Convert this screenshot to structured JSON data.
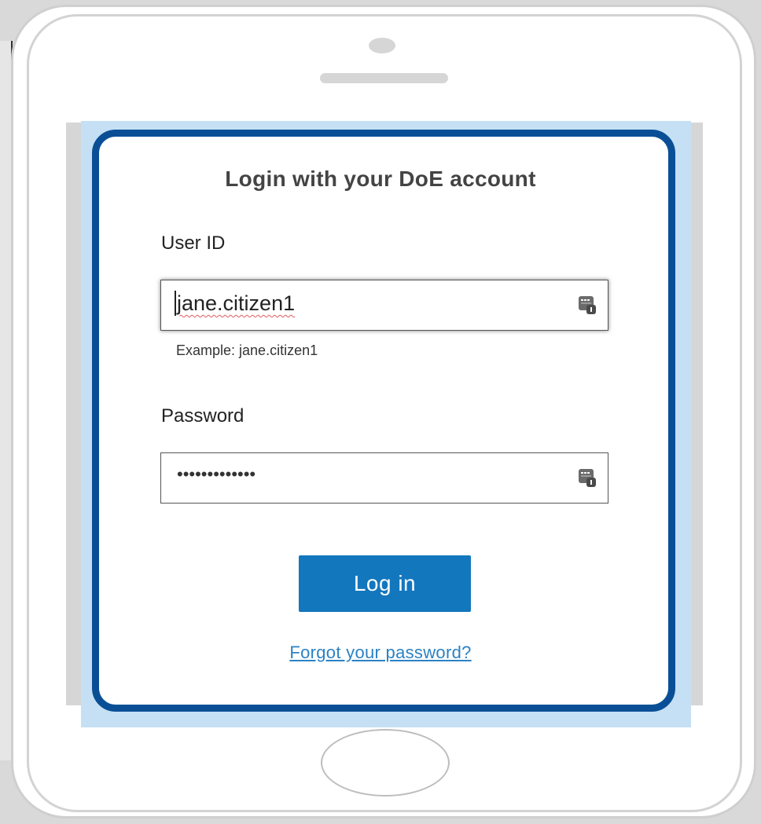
{
  "login": {
    "title": "Login with your DoE account",
    "userid_label": "User ID",
    "userid_value": "jane.citizen1",
    "userid_example": "Example: jane.citizen1",
    "password_label": "Password",
    "password_masked": "•••••••••••••",
    "login_button": "Log in",
    "forgot_link": "Forgot your password?"
  },
  "icons": {
    "field_icon": "password-manager-key-icon"
  },
  "colors": {
    "card_border": "#0a4f96",
    "button": "#1377be",
    "link": "#2b82c4",
    "screen_background": "#c5e0f4"
  }
}
